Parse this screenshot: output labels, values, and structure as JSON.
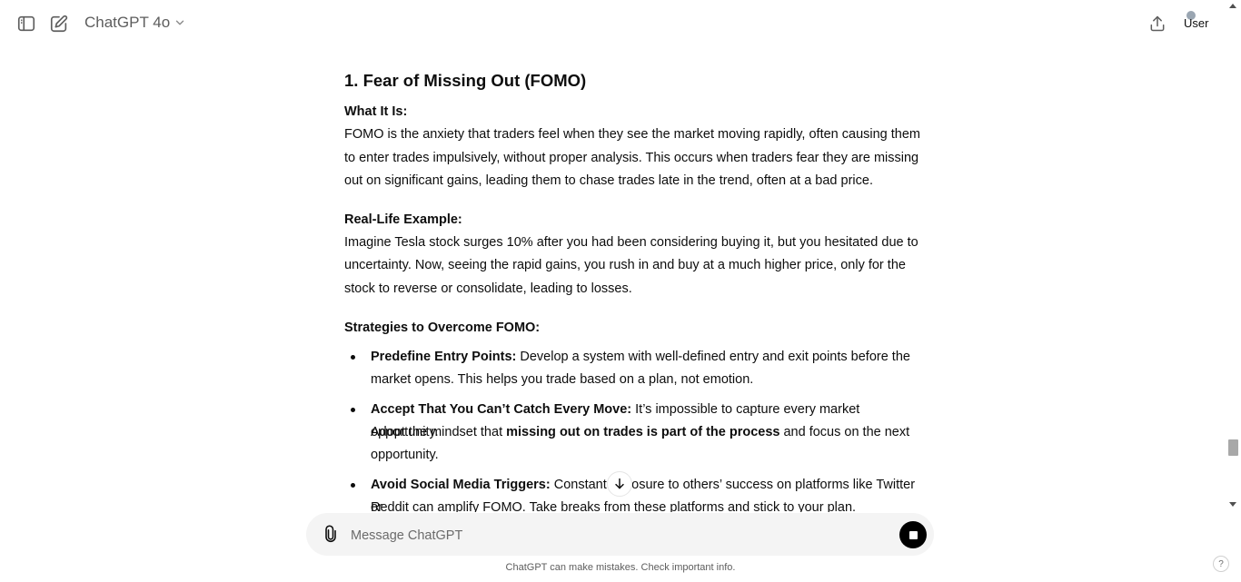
{
  "header": {
    "model_name": "ChatGPT 4o",
    "user_name": "User"
  },
  "message": {
    "heading": "1. Fear of Missing Out (FOMO)",
    "what_label": "What It Is:",
    "what_lines": [
      "FOMO is the anxiety that traders feel when they see the market moving rapidly, often causing them",
      "to enter trades impulsively, without proper analysis. This occurs when traders fear they are missing",
      "out on significant gains, leading them to chase trades late in the trend, often at a bad price."
    ],
    "example_label": "Real-Life Example:",
    "example_lines": [
      "Imagine Tesla stock surges 10% after you had been considering buying it, but you hesitated due to",
      "uncertainty. Now, seeing the rapid gains, you rush in and buy at a much higher price, only for the",
      "stock to reverse or consolidate, leading to losses."
    ],
    "strategies_label": "Strategies to Overcome FOMO:",
    "bullets": [
      {
        "title": "Predefine Entry Points:",
        "line1": " Develop a system with well-defined entry and exit points before the",
        "line2": "market opens. This helps you trade based on a plan, not emotion."
      },
      {
        "title": "Accept That You Can’t Catch Every Move:",
        "line1": " It’s impossible to capture every market opportunity.",
        "line2_pre": "Adopt the mindset that ",
        "line2_bold": "missing out on trades is part of the process",
        "line2_post": " and focus on the next",
        "line3": "opportunity."
      },
      {
        "title": "Avoid Social Media Triggers:",
        "line1": " Constant exposure to others’ success on platforms like Twitter or",
        "line2": "Reddit can amplify FOMO. Take breaks from these platforms and stick to your plan."
      }
    ]
  },
  "composer": {
    "placeholder": "Message ChatGPT"
  },
  "footer": {
    "disclaimer": "ChatGPT can make mistakes. Check important info.",
    "help": "?"
  }
}
